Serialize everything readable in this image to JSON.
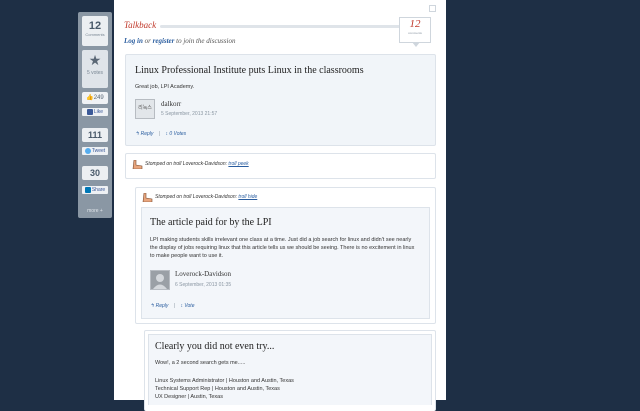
{
  "share_bar": {
    "comments_count": "12",
    "comments_label": "Comments",
    "votes_count": "5",
    "votes_label": "votes",
    "facebook_count": "249",
    "facebook_label": "Like",
    "twitter_count": "111",
    "twitter_label": "Tweet",
    "linkedin_count": "30",
    "linkedin_label": "Share",
    "more_label": "more +"
  },
  "talkback": {
    "title": "Talkback",
    "count": "12",
    "count_label": "comments",
    "login_link": "Log in",
    "or_text": "or",
    "register_link": "register",
    "join_text": "to join the discussion"
  },
  "comments": [
    {
      "title": "Linux Professional Institute puts Linux in the classrooms",
      "body": "Great job, LPI Academy.",
      "author": "dalkorr",
      "avatar_text": "리눅스",
      "date": "5 September, 2013 21:57",
      "reply": "Reply",
      "votes": "0 Votes"
    },
    {
      "stomped_text": "Stomped on troll Loverock-Davidson:",
      "stomped_link": "troll peek"
    },
    {
      "stomped_text": "Stomped on troll Loverock-Davidson:",
      "stomped_link": "troll hide",
      "title": "The article paid for by the LPI",
      "body": "LPI making students skills irrelevant one class at a time. Just did a job search for linux and didn't see nearly the display of jobs requiring linux that this article tells us we should be seeing. There is no excitement in linux to make people want to use it.",
      "author": "Loverock-Davidson",
      "date": "6 September, 2013 01:35",
      "reply": "Reply",
      "votes": "Vote"
    },
    {
      "title": "Clearly you did not even try...",
      "body": "Wow!, a 2 second search gets me.....",
      "lines": [
        "Linux Systems Administrator | Houston and Austin, Texas",
        "Technical Support Rep | Houston and Austin, Texas",
        "UX Designer | Austin, Texas"
      ]
    }
  ],
  "colors": {
    "background": "#1e2f45",
    "accent_red": "#c0392b",
    "link_blue": "#2a5d9f"
  }
}
